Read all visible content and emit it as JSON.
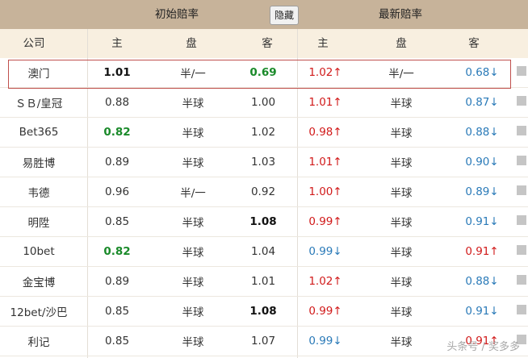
{
  "header": {
    "initial_odds": "初始赔率",
    "hide_button": "隐藏",
    "latest_odds": "最新赔率"
  },
  "columns": [
    "公司",
    "主",
    "盘",
    "客",
    "主",
    "盘",
    "客"
  ],
  "rows": [
    {
      "company": "澳门",
      "init_home": "1.01",
      "init_line": "半/一",
      "init_away": "0.69",
      "new_home": "1.02↑",
      "new_line": "半/一",
      "new_away": "0.68↓"
    },
    {
      "company": "ＳＢ/皇冠",
      "init_home": "0.88",
      "init_line": "半球",
      "init_away": "1.00",
      "new_home": "1.01↑",
      "new_line": "半球",
      "new_away": "0.87↓"
    },
    {
      "company": "Bet365",
      "init_home": "0.82",
      "init_line": "半球",
      "init_away": "1.02",
      "new_home": "0.98↑",
      "new_line": "半球",
      "new_away": "0.88↓"
    },
    {
      "company": "易胜博",
      "init_home": "0.89",
      "init_line": "半球",
      "init_away": "1.03",
      "new_home": "1.01↑",
      "new_line": "半球",
      "new_away": "0.90↓"
    },
    {
      "company": "韦德",
      "init_home": "0.96",
      "init_line": "半/一",
      "init_away": "0.92",
      "new_home": "1.00↑",
      "new_line": "半球",
      "new_away": "0.89↓"
    },
    {
      "company": "明陞",
      "init_home": "0.85",
      "init_line": "半球",
      "init_away": "1.08",
      "new_home": "0.99↑",
      "new_line": "半球",
      "new_away": "0.91↓"
    },
    {
      "company": "10bet",
      "init_home": "0.82",
      "init_line": "半球",
      "init_away": "1.04",
      "new_home": "0.99↓",
      "new_line": "半球",
      "new_away": "0.91↑"
    },
    {
      "company": "金宝博",
      "init_home": "0.89",
      "init_line": "半球",
      "init_away": "1.01",
      "new_home": "1.02↑",
      "new_line": "半球",
      "new_away": "0.88↓"
    },
    {
      "company": "12bet/沙巴",
      "init_home": "0.85",
      "init_line": "半球",
      "init_away": "1.08",
      "new_home": "0.99↑",
      "new_line": "半球",
      "new_away": "0.91↓"
    },
    {
      "company": "利记",
      "init_home": "0.85",
      "init_line": "半球",
      "init_away": "1.07",
      "new_home": "0.99↓",
      "new_line": "半球",
      "new_away": "0.91↑"
    }
  ],
  "watermark": "头条号 / 奖多多",
  "colors": {
    "up": "#d11a1a",
    "down": "#2a7ab8",
    "low_green": "#1a8a2a",
    "highlight_border": "#c0504d",
    "header_bg": "#c7b39a",
    "subheader_bg": "#f8efe0"
  }
}
